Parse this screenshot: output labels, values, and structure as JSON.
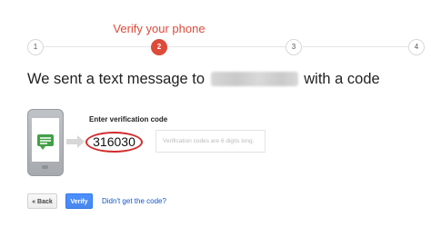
{
  "progress": {
    "title": "Verify your phone",
    "steps": [
      "1",
      "2",
      "3",
      "4"
    ],
    "active_step": 2
  },
  "headline": {
    "prefix": "We sent a text message to",
    "suffix": "with a code"
  },
  "verification": {
    "label": "Enter verification code",
    "code_value": "316030",
    "hint_placeholder": "Verification codes are 6 digits long."
  },
  "actions": {
    "back_label": "« Back",
    "verify_label": "Verify",
    "resend_link": "Didn't get the code?"
  },
  "colors": {
    "accent_red": "#dd4b39",
    "primary_blue": "#4d90fe",
    "link_blue": "#1155cc",
    "message_green": "#43a047"
  },
  "icons": {
    "phone": "phone-icon",
    "message": "message-bubble-icon",
    "arrow": "arrow-right-icon"
  }
}
